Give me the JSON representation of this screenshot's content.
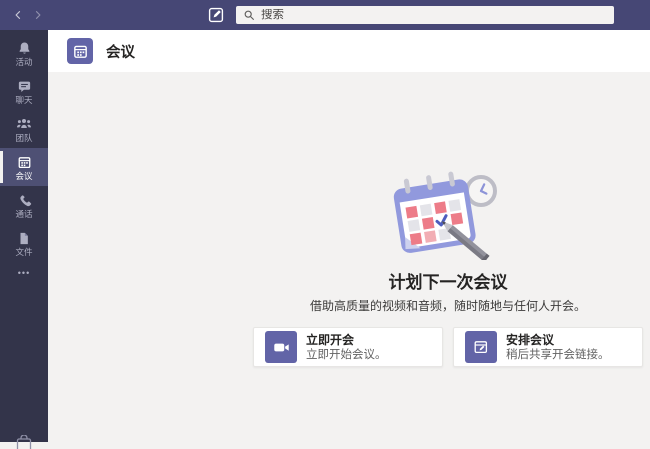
{
  "colors": {
    "topbar": "#464775",
    "sidebar": "#33344a",
    "sidebar_selected": "#4e5074",
    "accent": "#6264a7",
    "content_bg": "#f3f2f1",
    "calendar_red": "#ed7c88"
  },
  "topbar": {
    "search": {
      "placeholder": "搜索"
    }
  },
  "sidebar": {
    "items": [
      {
        "label": "活动",
        "icon": "bell-icon",
        "selected": false
      },
      {
        "label": "聊天",
        "icon": "chat-icon",
        "selected": false
      },
      {
        "label": "团队",
        "icon": "people-icon",
        "selected": false
      },
      {
        "label": "会议",
        "icon": "calendar-icon",
        "selected": true
      },
      {
        "label": "通话",
        "icon": "phone-icon",
        "selected": false
      },
      {
        "label": "文件",
        "icon": "file-icon",
        "selected": false
      }
    ],
    "more_label": "•••"
  },
  "header": {
    "title": "会议"
  },
  "empty_state": {
    "title": "计划下一次会议",
    "subtitle": "借助高质量的视频和音频，随时随地与任何人开会。",
    "actions": [
      {
        "label": "立即开会",
        "description": "立即开始会议。",
        "icon": "video-camera-icon"
      },
      {
        "label": "安排会议",
        "description": "稍后共享开会链接。",
        "icon": "calendar-add-icon"
      }
    ]
  }
}
